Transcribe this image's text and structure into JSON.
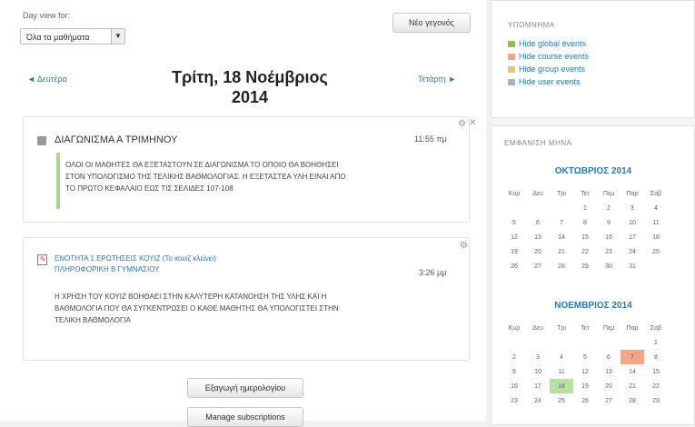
{
  "view": {
    "label": "Day view for:",
    "select_value": "Όλα τα μαθήματα"
  },
  "new_event_label": "Νέο γεγονός",
  "nav": {
    "prev": "◄ Δευτέρα",
    "next": "Τετάρτη ►"
  },
  "day_title_line1": "Τρίτη, 18 Νοέμβριος",
  "day_title_line2": "2014",
  "events": [
    {
      "title": "ΔΙΑΓΩΝΙΣΜΑ Α ΤΡΙΜΗΝΟΥ",
      "time": "11:55 πμ",
      "description_lines": [
        "ΟΛΟΙ ΟΙ ΜΑΘΗΤΕΣ ΘΑ ΕΞΕΤΑΣΤΟΥΝ ΣΕ ΔΙΑΓΩΝΙΣΜΑ ΤΟ ΟΠΟΙΟ ΘΑ ΒΟΗΘΗΣΕΙ",
        "ΣΤΟΝ ΥΠΟΛΟΓΙΣΜΟ ΤΗΣ ΤΕΛΙΚΗΣ ΒΑΘΜΟΛΟΓΙΑΣ. Η ΕΞΕΤΑΣΤΕΑ ΥΛΗ ΕΙΝΑΙ ΑΠΟ",
        "ΤΟ ΠΡΩΤΟ ΚΕΦΑΛΑΙΟ ΕΩΣ ΤΙΣ ΣΕΛΙΔΕΣ 107-108"
      ]
    },
    {
      "link_line1": "ΕΝΟΤΗΤΑ 1 ΕΡΩΤΗΣΕΙΣ ΚΟΥΙΖ (Το κουίζ κλείνει)",
      "link_line2": "ΠΛΗΡΟΦΟΡΙΚΗ Β ΓΥΜΝΑΣΙΟΥ",
      "time": "3:26 μμ",
      "description_lines": [
        "Η ΧΡΗΣΗ ΤΟΥ ΚΟΥΙΖ ΒΟΗΘΑΕΙ ΣΤΗΝ ΚΑΛΥΤΕΡΗ ΚΑΤΑΝΟΗΣΗ ΤΗΣ ΥΛΗΣ ΚΑΙ Η",
        "ΒΑΘΜΟΛΟΓΙΑ ΠΟΥ ΘΑ ΣΥΓΚΕΝΤΡΩΣΕΙ Ο ΚΑΘΕ ΜΑΘΗΤΗΣ ΘΑ ΥΠΟΛΟΓΙΣΤΕΙ ΣΤΗΝ",
        "ΤΕΛΙΚΗ ΒΑΘΜΟΛΟΓΙΑ"
      ]
    }
  ],
  "export_label": "Εξαγωγή ημερολογίου",
  "manage_label": "Manage subscriptions",
  "legend": {
    "heading": "ΥΠΟΜΝΗΜΑ",
    "items": [
      {
        "label": "Hide global events",
        "color": "#8bc34a"
      },
      {
        "label": "Hide course events",
        "color": "#f4a58a"
      },
      {
        "label": "Hide group events",
        "color": "#f0c36d"
      },
      {
        "label": "Hide user events",
        "color": "#9fb6cd"
      }
    ]
  },
  "month_view": {
    "heading": "ΕΜΦΑΝΙΣΗ ΜΗΝΑ",
    "weekdays": [
      "Κυρ",
      "Δευ",
      "Τρι",
      "Τετ",
      "Πεμ",
      "Παρ",
      "Σαβ"
    ],
    "months": [
      {
        "title": "ΟΚΤΩΒΡΙΟΣ 2014",
        "weeks": [
          [
            "",
            "",
            "",
            "1",
            "2",
            "3",
            "4"
          ],
          [
            "5",
            "6",
            "7",
            "8",
            "9",
            "10",
            "11"
          ],
          [
            "12",
            "13",
            "14",
            "15",
            "16",
            "17",
            "18"
          ],
          [
            "19",
            "20",
            "21",
            "22",
            "23",
            "24",
            "25"
          ],
          [
            "26",
            "27",
            "28",
            "29",
            "30",
            "31",
            ""
          ]
        ]
      },
      {
        "title": "ΝΟΕΜΒΡΙΟΣ 2014",
        "weeks": [
          [
            "",
            "",
            "",
            "",
            "",
            "",
            "1"
          ],
          [
            "2",
            "3",
            "4",
            "5",
            "6",
            "7",
            "8"
          ],
          [
            "9",
            "10",
            "11",
            "12",
            "13",
            "14",
            "15"
          ],
          [
            "16",
            "17",
            "18",
            "19",
            "20",
            "21",
            "22"
          ],
          [
            "23",
            "24",
            "25",
            "26",
            "27",
            "28",
            "29"
          ]
        ]
      }
    ]
  }
}
